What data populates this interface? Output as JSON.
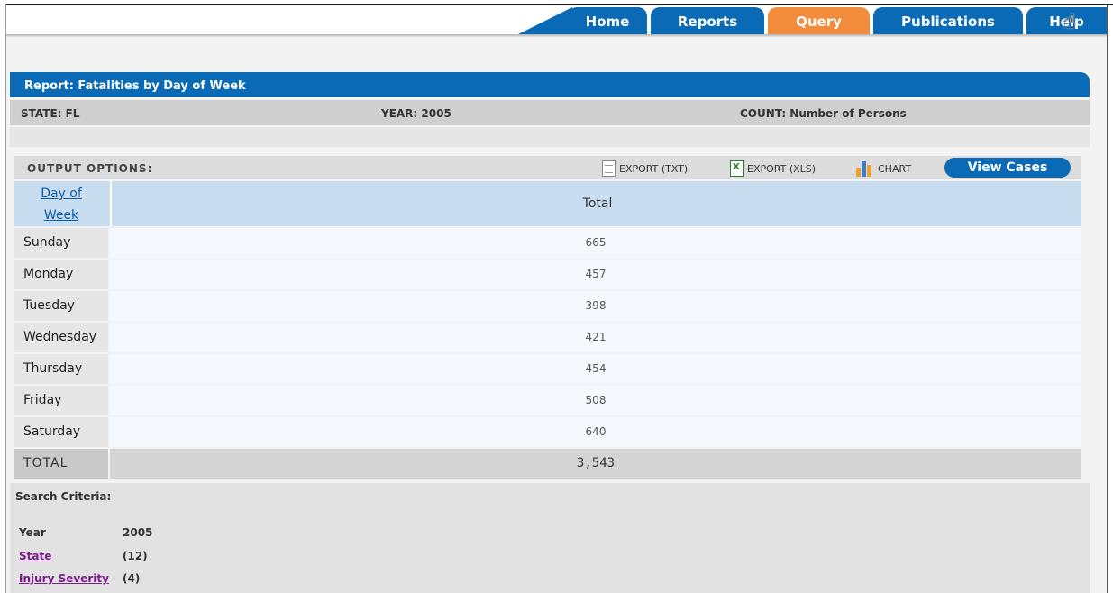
{
  "nav": {
    "tabs": [
      {
        "label": "Home"
      },
      {
        "label": "Reports"
      },
      {
        "label": "Query"
      },
      {
        "label": "Publications"
      },
      {
        "label": "Help"
      }
    ],
    "active_tab": "Query"
  },
  "report": {
    "title": "Report: Fatalities by Day of Week",
    "state": "STATE: FL",
    "year": "YEAR: 2005",
    "count": "COUNT: Number of Persons"
  },
  "output_options": {
    "label": "OUTPUT OPTIONS:",
    "export_txt": "EXPORT (TXT)",
    "export_xls": "EXPORT (XLS)",
    "chart": "CHART",
    "view_cases": "View Cases"
  },
  "table": {
    "header_day": [
      "Day of",
      "Week"
    ],
    "header_total": "Total",
    "rows": [
      {
        "day": "Sunday",
        "total": "665"
      },
      {
        "day": "Monday",
        "total": "457"
      },
      {
        "day": "Tuesday",
        "total": "398"
      },
      {
        "day": "Wednesday",
        "total": "421"
      },
      {
        "day": "Thursday",
        "total": "454"
      },
      {
        "day": "Friday",
        "total": "508"
      },
      {
        "day": "Saturday",
        "total": "640"
      }
    ],
    "total_label": "TOTAL",
    "total_value": "3,543"
  },
  "search_criteria": {
    "title": "Search Criteria:",
    "items": [
      {
        "label": "Year",
        "value": "2005",
        "link": false
      },
      {
        "label": "State",
        "value": "(12)",
        "link": true
      },
      {
        "label": "Injury Severity",
        "value": "(4)",
        "link": true
      }
    ]
  },
  "colors": {
    "nav_blue": "#0a6ab5",
    "active_orange": "#f28b3c",
    "link_purple": "#7b1b8a"
  },
  "icons": [
    "export-txt-icon",
    "export-xls-icon",
    "chart-icon",
    "hand-cursor-icon"
  ]
}
